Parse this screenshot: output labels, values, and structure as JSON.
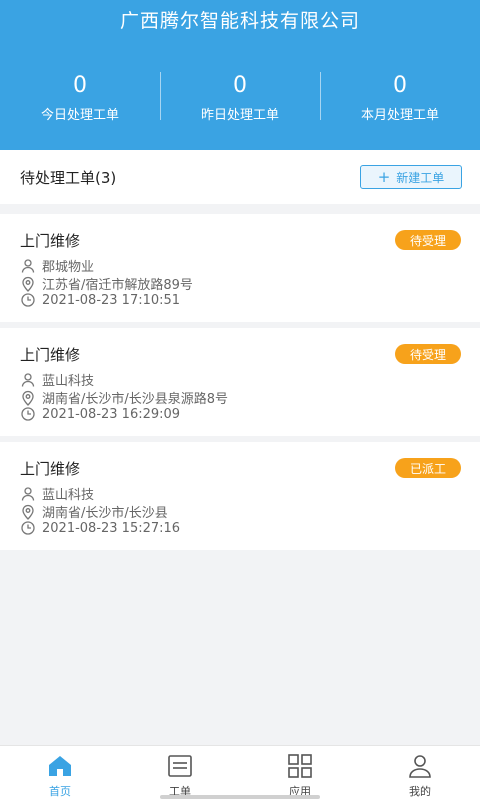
{
  "header": {
    "title": "广西腾尔智能科技有限公司",
    "stats": [
      {
        "value": "0",
        "label": "今日处理工单"
      },
      {
        "value": "0",
        "label": "昨日处理工单"
      },
      {
        "value": "0",
        "label": "本月处理工单"
      }
    ]
  },
  "pending": {
    "title": "待处理工单(3)",
    "new_button_label": "新建工单",
    "new_button_icon": "plus-icon"
  },
  "orders": [
    {
      "title": "上门维修",
      "status": "待受理",
      "company": "郡城物业",
      "address": "江苏省/宿迁市解放路89号",
      "time": "2021-08-23 17:10:51"
    },
    {
      "title": "上门维修",
      "status": "待受理",
      "company": "蓝山科技",
      "address": "湖南省/长沙市/长沙县泉源路8号",
      "time": "2021-08-23 16:29:09"
    },
    {
      "title": "上门维修",
      "status": "已派工",
      "company": "蓝山科技",
      "address": "湖南省/长沙市/长沙县",
      "time": "2021-08-23 15:27:16"
    }
  ],
  "tabs": [
    {
      "label": "首页",
      "icon": "home-icon",
      "active": true
    },
    {
      "label": "工单",
      "icon": "list-icon",
      "active": false
    },
    {
      "label": "应用",
      "icon": "grid-icon",
      "active": false
    },
    {
      "label": "我的",
      "icon": "user-icon",
      "active": false
    }
  ],
  "colors": {
    "accent": "#3aa3e3",
    "badge": "#f7a21b"
  }
}
